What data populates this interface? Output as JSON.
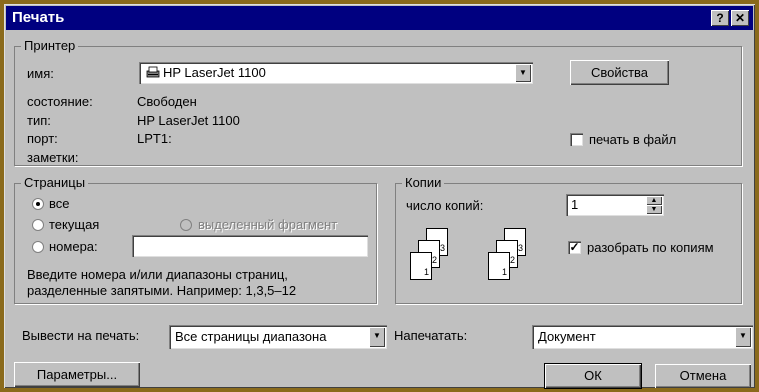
{
  "window": {
    "title": "Печать",
    "help": "?",
    "close": "✕"
  },
  "printer": {
    "legend": "Принтер",
    "name_label": "имя:",
    "name_value": "HP LaserJet 1100",
    "properties_button": "Свойства",
    "status_label": "состояние:",
    "status_value": "Свободен",
    "type_label": "тип:",
    "type_value": "HP LaserJet 1100",
    "port_label": "порт:",
    "port_value": "LPT1:",
    "notes_label": "заметки:",
    "print_to_file_label": "печать в файл",
    "print_to_file_checked": false
  },
  "pages": {
    "legend": "Страницы",
    "all_label": "все",
    "current_label": "текущая",
    "selection_label": "выделенный фрагмент",
    "numbers_label": "номера:",
    "numbers_value": "",
    "selected": "all",
    "hint_line1": "Введите номера и/или диапазоны страниц,",
    "hint_line2": "разделенные запятыми. Например: 1,3,5–12"
  },
  "copies": {
    "legend": "Копии",
    "count_label": "число копий:",
    "count_value": "1",
    "collate_label": "разобрать по копиям",
    "collate_checked": true,
    "stack_collated": [
      "1",
      "2",
      "3"
    ],
    "stack_uncollated": [
      "1",
      "2",
      "3"
    ]
  },
  "bottom": {
    "print_what_label": "Вывести на печать:",
    "print_what_value": "Все страницы диапазона",
    "print_label": "Напечатать:",
    "print_value": "Документ",
    "options_button": "Параметры...",
    "ok_button": "ОК",
    "cancel_button": "Отмена"
  },
  "icons": {
    "printer": "printer-icon",
    "dropdown": "▼",
    "spin_up": "▲",
    "spin_down": "▼",
    "check": "✓"
  }
}
